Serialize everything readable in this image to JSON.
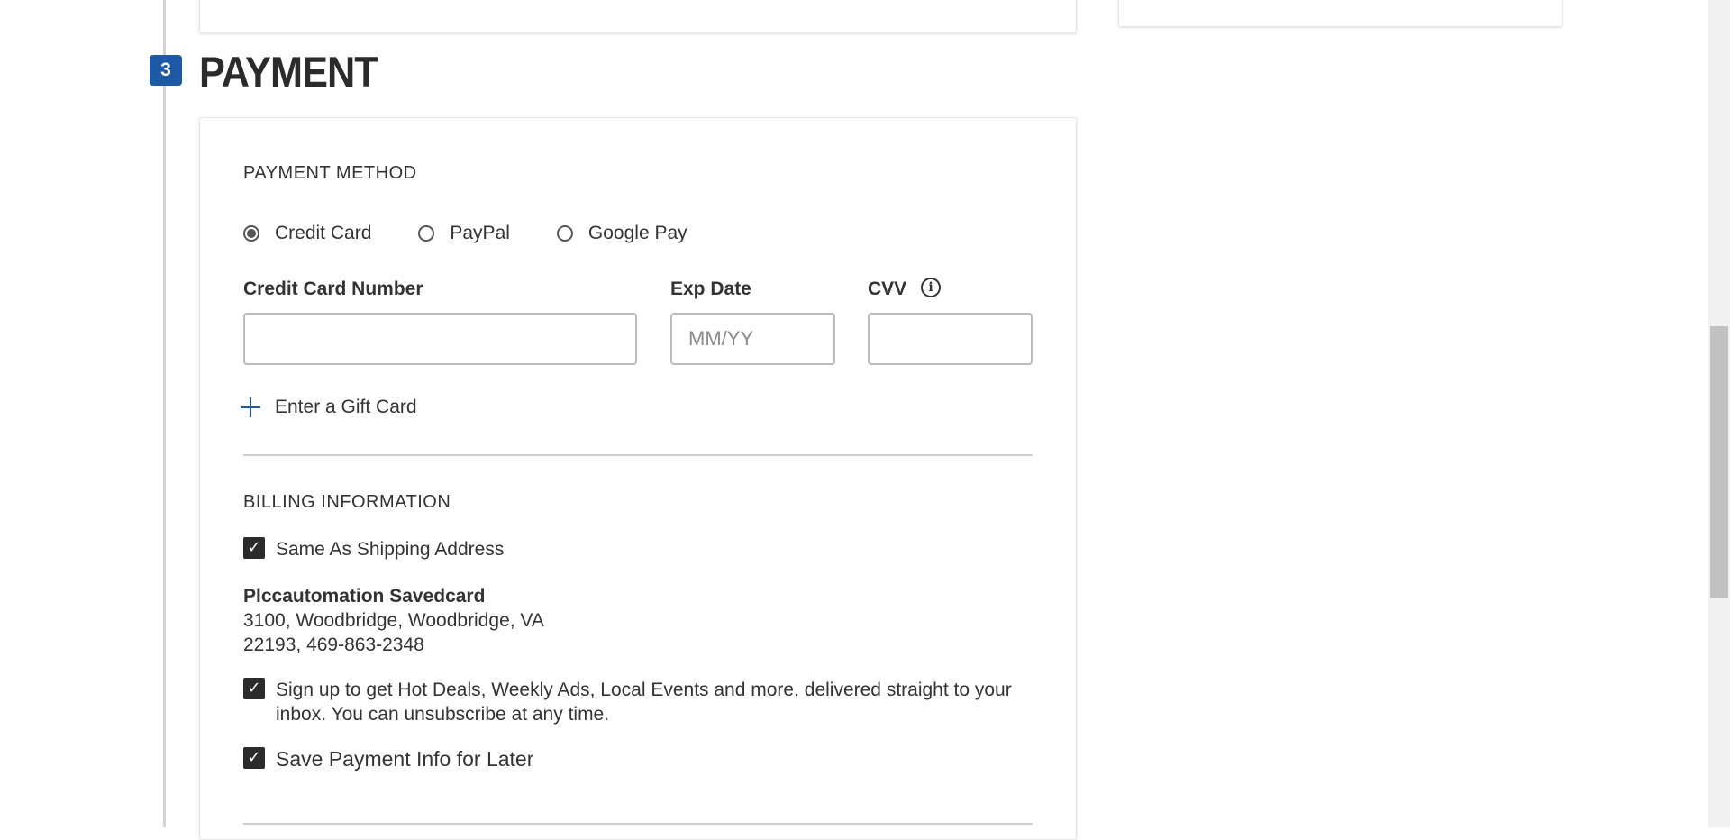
{
  "step": {
    "number": "3",
    "title": "PAYMENT"
  },
  "payment_method": {
    "heading": "PAYMENT METHOD",
    "options": [
      {
        "label": "Credit Card",
        "selected": true
      },
      {
        "label": "PayPal",
        "selected": false
      },
      {
        "label": "Google Pay",
        "selected": false
      }
    ]
  },
  "card_form": {
    "card_number_label": "Credit Card Number",
    "card_number_value": "",
    "exp_label": "Exp Date",
    "exp_placeholder": "MM/YY",
    "cvv_label": "CVV",
    "cvv_value": "",
    "info_icon": "info-icon"
  },
  "gift_card": {
    "label": "Enter a Gift Card",
    "icon": "plus-icon"
  },
  "billing": {
    "heading": "BILLING INFORMATION",
    "same_as_shipping_label": "Same As Shipping Address",
    "same_as_shipping_checked": true,
    "address": {
      "name": "Plccautomation Savedcard",
      "line1": "3100, Woodbridge, Woodbridge, VA",
      "line2": "22193, 469-863-2348"
    },
    "signup_label": "Sign up to get Hot Deals, Weekly Ads, Local Events and more, delivered straight to your inbox. You can unsubscribe at any time.",
    "signup_checked": true,
    "save_payment_label": "Save Payment Info for Later",
    "save_payment_checked": true
  },
  "colors": {
    "accent": "#1c5aa6",
    "checkbox": "#2b2b2b",
    "text": "#333333"
  }
}
